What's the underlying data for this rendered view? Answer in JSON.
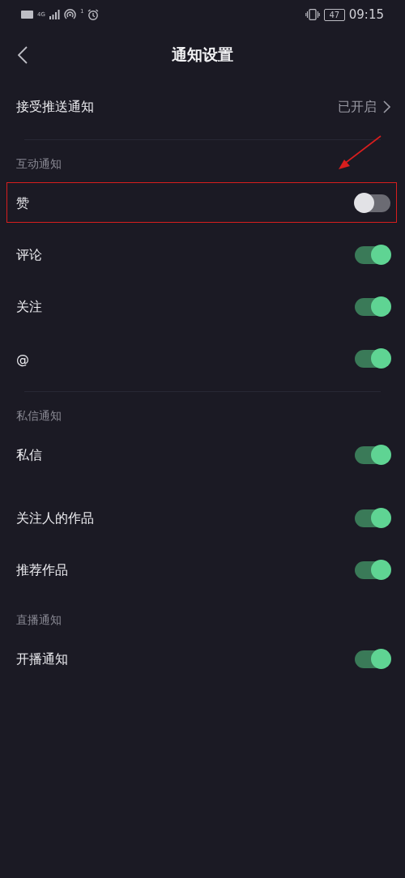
{
  "status_bar": {
    "network": "4G",
    "hotspot_count": "1",
    "battery": "47",
    "time": "09:15"
  },
  "header": {
    "title": "通知设置"
  },
  "groups": [
    {
      "rows": [
        {
          "kind": "link",
          "label": "接受推送通知",
          "value": "已开启"
        }
      ],
      "divider": true
    },
    {
      "label": "互动通知",
      "rows": [
        {
          "kind": "toggle",
          "label": "赞",
          "on": false,
          "highlighted": true
        },
        {
          "kind": "toggle",
          "label": "评论",
          "on": true,
          "highlighted": false
        },
        {
          "kind": "toggle",
          "label": "关注",
          "on": true,
          "highlighted": false
        },
        {
          "kind": "toggle",
          "label": "@",
          "on": true,
          "highlighted": false
        }
      ],
      "divider": true
    },
    {
      "label": "私信通知",
      "rows": [
        {
          "kind": "toggle",
          "label": "私信",
          "on": true,
          "highlighted": false
        }
      ],
      "divider": false
    },
    {
      "rows": [
        {
          "kind": "toggle",
          "label": "关注人的作品",
          "on": true,
          "highlighted": false
        },
        {
          "kind": "toggle",
          "label": "推荐作品",
          "on": true,
          "highlighted": false
        }
      ],
      "divider": false
    },
    {
      "label": "直播通知",
      "rows": [
        {
          "kind": "toggle",
          "label": "开播通知",
          "on": true,
          "highlighted": false
        }
      ],
      "divider": false
    }
  ]
}
